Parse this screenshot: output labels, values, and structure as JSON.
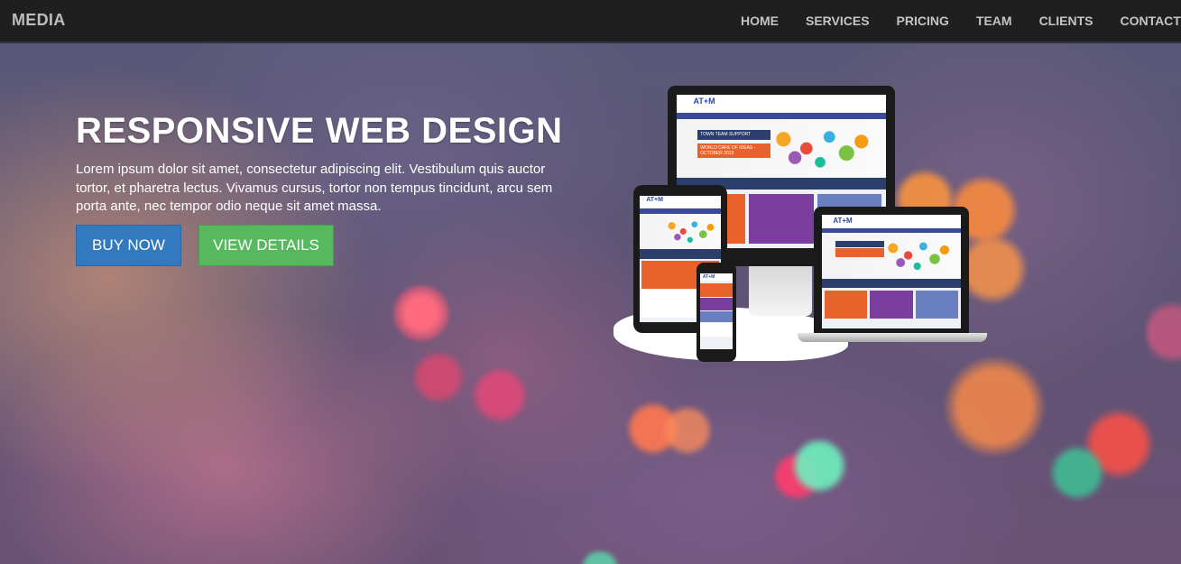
{
  "navbar": {
    "brand": "MEDIA",
    "items": [
      {
        "label": "HOME"
      },
      {
        "label": "SERVICES"
      },
      {
        "label": "PRICING"
      },
      {
        "label": "TEAM"
      },
      {
        "label": "CLIENTS"
      },
      {
        "label": "CONTACT"
      }
    ]
  },
  "hero": {
    "title": "RESPONSIVE WEB DESIGN",
    "text": "Lorem ipsum dolor sit amet, consectetur adipiscing elit. Vestibulum quis auctor tortor, et pharetra lectus. Vivamus cursus, tortor non tempus tincidunt, arcu sem porta ante, nec tempor odio neque sit amet massa.",
    "buy_label": "BUY NOW",
    "details_label": "VIEW DETAILS"
  },
  "devices_image": {
    "site_logo": "AT+M",
    "tag_line_1": "TOWN TEAM SUPPORT",
    "tag_line_2": "WORLD CAFE OF IDEAS - OCTOBER 2013"
  },
  "colors": {
    "navbar_bg": "#1f1f1f",
    "buy_button": "#3379bf",
    "details_button": "#56b95d"
  }
}
